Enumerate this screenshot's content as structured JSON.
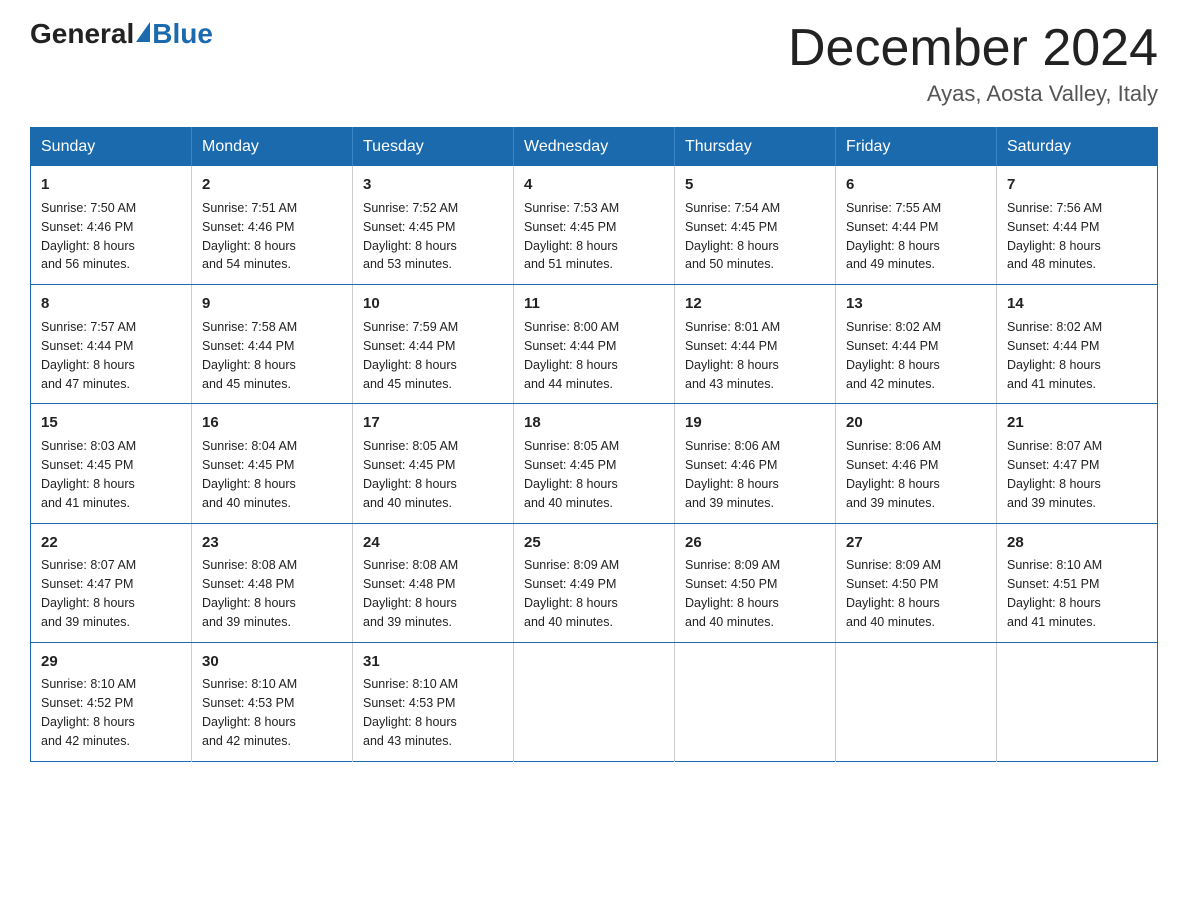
{
  "header": {
    "logo_general": "General",
    "logo_blue": "Blue",
    "month_title": "December 2024",
    "location": "Ayas, Aosta Valley, Italy"
  },
  "weekdays": [
    "Sunday",
    "Monday",
    "Tuesday",
    "Wednesday",
    "Thursday",
    "Friday",
    "Saturday"
  ],
  "weeks": [
    [
      {
        "day": "1",
        "sunrise": "7:50 AM",
        "sunset": "4:46 PM",
        "daylight": "8 hours and 56 minutes."
      },
      {
        "day": "2",
        "sunrise": "7:51 AM",
        "sunset": "4:46 PM",
        "daylight": "8 hours and 54 minutes."
      },
      {
        "day": "3",
        "sunrise": "7:52 AM",
        "sunset": "4:45 PM",
        "daylight": "8 hours and 53 minutes."
      },
      {
        "day": "4",
        "sunrise": "7:53 AM",
        "sunset": "4:45 PM",
        "daylight": "8 hours and 51 minutes."
      },
      {
        "day": "5",
        "sunrise": "7:54 AM",
        "sunset": "4:45 PM",
        "daylight": "8 hours and 50 minutes."
      },
      {
        "day": "6",
        "sunrise": "7:55 AM",
        "sunset": "4:44 PM",
        "daylight": "8 hours and 49 minutes."
      },
      {
        "day": "7",
        "sunrise": "7:56 AM",
        "sunset": "4:44 PM",
        "daylight": "8 hours and 48 minutes."
      }
    ],
    [
      {
        "day": "8",
        "sunrise": "7:57 AM",
        "sunset": "4:44 PM",
        "daylight": "8 hours and 47 minutes."
      },
      {
        "day": "9",
        "sunrise": "7:58 AM",
        "sunset": "4:44 PM",
        "daylight": "8 hours and 45 minutes."
      },
      {
        "day": "10",
        "sunrise": "7:59 AM",
        "sunset": "4:44 PM",
        "daylight": "8 hours and 45 minutes."
      },
      {
        "day": "11",
        "sunrise": "8:00 AM",
        "sunset": "4:44 PM",
        "daylight": "8 hours and 44 minutes."
      },
      {
        "day": "12",
        "sunrise": "8:01 AM",
        "sunset": "4:44 PM",
        "daylight": "8 hours and 43 minutes."
      },
      {
        "day": "13",
        "sunrise": "8:02 AM",
        "sunset": "4:44 PM",
        "daylight": "8 hours and 42 minutes."
      },
      {
        "day": "14",
        "sunrise": "8:02 AM",
        "sunset": "4:44 PM",
        "daylight": "8 hours and 41 minutes."
      }
    ],
    [
      {
        "day": "15",
        "sunrise": "8:03 AM",
        "sunset": "4:45 PM",
        "daylight": "8 hours and 41 minutes."
      },
      {
        "day": "16",
        "sunrise": "8:04 AM",
        "sunset": "4:45 PM",
        "daylight": "8 hours and 40 minutes."
      },
      {
        "day": "17",
        "sunrise": "8:05 AM",
        "sunset": "4:45 PM",
        "daylight": "8 hours and 40 minutes."
      },
      {
        "day": "18",
        "sunrise": "8:05 AM",
        "sunset": "4:45 PM",
        "daylight": "8 hours and 40 minutes."
      },
      {
        "day": "19",
        "sunrise": "8:06 AM",
        "sunset": "4:46 PM",
        "daylight": "8 hours and 39 minutes."
      },
      {
        "day": "20",
        "sunrise": "8:06 AM",
        "sunset": "4:46 PM",
        "daylight": "8 hours and 39 minutes."
      },
      {
        "day": "21",
        "sunrise": "8:07 AM",
        "sunset": "4:47 PM",
        "daylight": "8 hours and 39 minutes."
      }
    ],
    [
      {
        "day": "22",
        "sunrise": "8:07 AM",
        "sunset": "4:47 PM",
        "daylight": "8 hours and 39 minutes."
      },
      {
        "day": "23",
        "sunrise": "8:08 AM",
        "sunset": "4:48 PM",
        "daylight": "8 hours and 39 minutes."
      },
      {
        "day": "24",
        "sunrise": "8:08 AM",
        "sunset": "4:48 PM",
        "daylight": "8 hours and 39 minutes."
      },
      {
        "day": "25",
        "sunrise": "8:09 AM",
        "sunset": "4:49 PM",
        "daylight": "8 hours and 40 minutes."
      },
      {
        "day": "26",
        "sunrise": "8:09 AM",
        "sunset": "4:50 PM",
        "daylight": "8 hours and 40 minutes."
      },
      {
        "day": "27",
        "sunrise": "8:09 AM",
        "sunset": "4:50 PM",
        "daylight": "8 hours and 40 minutes."
      },
      {
        "day": "28",
        "sunrise": "8:10 AM",
        "sunset": "4:51 PM",
        "daylight": "8 hours and 41 minutes."
      }
    ],
    [
      {
        "day": "29",
        "sunrise": "8:10 AM",
        "sunset": "4:52 PM",
        "daylight": "8 hours and 42 minutes."
      },
      {
        "day": "30",
        "sunrise": "8:10 AM",
        "sunset": "4:53 PM",
        "daylight": "8 hours and 42 minutes."
      },
      {
        "day": "31",
        "sunrise": "8:10 AM",
        "sunset": "4:53 PM",
        "daylight": "8 hours and 43 minutes."
      },
      null,
      null,
      null,
      null
    ]
  ],
  "labels": {
    "sunrise": "Sunrise:",
    "sunset": "Sunset:",
    "daylight": "Daylight:"
  }
}
